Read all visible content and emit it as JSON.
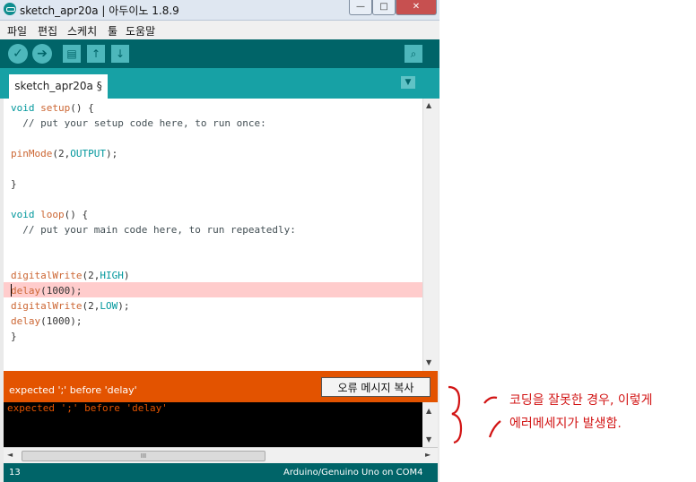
{
  "window": {
    "title": "sketch_apr20a | 아두이노 1.8.9",
    "controls": {
      "minimize": "—",
      "maximize": "□",
      "close": "✕"
    }
  },
  "menu": {
    "items": [
      "파일",
      "편집",
      "스케치",
      "툴",
      "도움말"
    ]
  },
  "toolbar": {
    "verify_icon": "✓",
    "upload_icon": "➔",
    "new_icon": "▤",
    "open_icon": "↑",
    "save_icon": "↓",
    "serial_icon": "⌕"
  },
  "tab": {
    "label": "sketch_apr20a §",
    "menu_icon": "▼"
  },
  "code": {
    "l1_kw": "void",
    "l1_fn": "setup",
    "l1_rest": "() {",
    "l2": "  // put your setup code here, to run once:",
    "l4_fn": "pinMode",
    "l4_a": "(2,",
    "l4_const": "OUTPUT",
    "l4_b": ");",
    "l6": "}",
    "l8_kw": "void",
    "l8_fn": "loop",
    "l8_rest": "() {",
    "l9": "  // put your main code here, to run repeatedly:",
    "l12_fn": "digitalWrite",
    "l12_a": "(2,",
    "l12_const": "HIGH",
    "l12_b": ")",
    "l13_fn": "delay",
    "l13_rest": "(1000);",
    "l14_fn": "digitalWrite",
    "l14_a": "(2,",
    "l14_const": "LOW",
    "l14_b": ");",
    "l15_fn": "delay",
    "l15_rest": "(1000);",
    "l16": "}"
  },
  "error": {
    "message": "expected ';' before 'delay'",
    "copy_button": "오류 메시지 복사",
    "console": "expected ';' before 'delay'"
  },
  "scroll": {
    "thumb": "III",
    "up": "▲",
    "down": "▼",
    "left": "◄",
    "right": "►"
  },
  "status": {
    "line": "13",
    "board": "Arduino/Genuino Uno on COM4"
  },
  "annotation": {
    "line1": "코딩을 잘못한 경우, 이렇게",
    "line2": "에러메세지가 발생함."
  },
  "colors": {
    "toolbar": "#006468",
    "tabbar": "#17a1a5",
    "error": "#e35300",
    "highlight": "#ffcccc",
    "annotation": "#d21414"
  }
}
